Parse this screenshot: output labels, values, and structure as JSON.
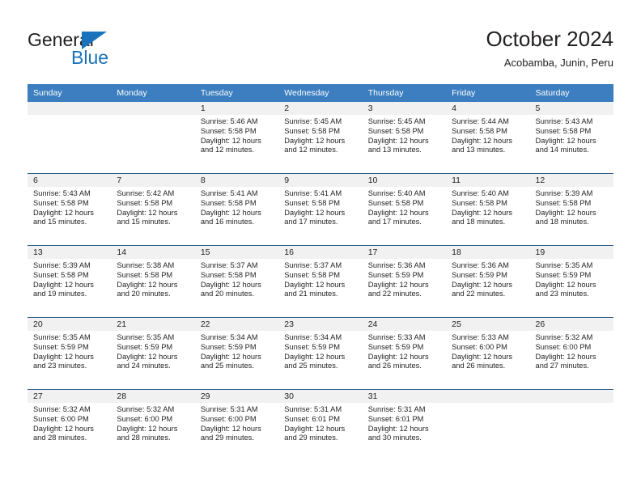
{
  "brand": {
    "name_part1": "General",
    "name_part2": "Blue",
    "triangle_color": "#1a72ba",
    "text_color": "#231f20"
  },
  "header": {
    "title": "October 2024",
    "subtitle": "Acobamba, Junin, Peru"
  },
  "theme": {
    "header_row_bg": "#3c7ebf",
    "header_row_text": "#ffffff",
    "row_separator": "#2e5f8c",
    "daynum_band_bg": "#f1f1f1",
    "cell_bg": "#ffffff",
    "body_text": "#231f20"
  },
  "calendar": {
    "weekday_headers": [
      "Sunday",
      "Monday",
      "Tuesday",
      "Wednesday",
      "Thursday",
      "Friday",
      "Saturday"
    ],
    "labels": {
      "sunrise": "Sunrise:",
      "sunset": "Sunset:",
      "daylight": "Daylight:"
    },
    "weeks": [
      [
        {
          "day": "",
          "line1": "",
          "line2": "",
          "line3": "",
          "line4": ""
        },
        {
          "day": "",
          "line1": "",
          "line2": "",
          "line3": "",
          "line4": ""
        },
        {
          "day": "1",
          "line1": "Sunrise: 5:46 AM",
          "line2": "Sunset: 5:58 PM",
          "line3": "Daylight: 12 hours",
          "line4": "and 12 minutes."
        },
        {
          "day": "2",
          "line1": "Sunrise: 5:45 AM",
          "line2": "Sunset: 5:58 PM",
          "line3": "Daylight: 12 hours",
          "line4": "and 12 minutes."
        },
        {
          "day": "3",
          "line1": "Sunrise: 5:45 AM",
          "line2": "Sunset: 5:58 PM",
          "line3": "Daylight: 12 hours",
          "line4": "and 13 minutes."
        },
        {
          "day": "4",
          "line1": "Sunrise: 5:44 AM",
          "line2": "Sunset: 5:58 PM",
          "line3": "Daylight: 12 hours",
          "line4": "and 13 minutes."
        },
        {
          "day": "5",
          "line1": "Sunrise: 5:43 AM",
          "line2": "Sunset: 5:58 PM",
          "line3": "Daylight: 12 hours",
          "line4": "and 14 minutes."
        }
      ],
      [
        {
          "day": "6",
          "line1": "Sunrise: 5:43 AM",
          "line2": "Sunset: 5:58 PM",
          "line3": "Daylight: 12 hours",
          "line4": "and 15 minutes."
        },
        {
          "day": "7",
          "line1": "Sunrise: 5:42 AM",
          "line2": "Sunset: 5:58 PM",
          "line3": "Daylight: 12 hours",
          "line4": "and 15 minutes."
        },
        {
          "day": "8",
          "line1": "Sunrise: 5:41 AM",
          "line2": "Sunset: 5:58 PM",
          "line3": "Daylight: 12 hours",
          "line4": "and 16 minutes."
        },
        {
          "day": "9",
          "line1": "Sunrise: 5:41 AM",
          "line2": "Sunset: 5:58 PM",
          "line3": "Daylight: 12 hours",
          "line4": "and 17 minutes."
        },
        {
          "day": "10",
          "line1": "Sunrise: 5:40 AM",
          "line2": "Sunset: 5:58 PM",
          "line3": "Daylight: 12 hours",
          "line4": "and 17 minutes."
        },
        {
          "day": "11",
          "line1": "Sunrise: 5:40 AM",
          "line2": "Sunset: 5:58 PM",
          "line3": "Daylight: 12 hours",
          "line4": "and 18 minutes."
        },
        {
          "day": "12",
          "line1": "Sunrise: 5:39 AM",
          "line2": "Sunset: 5:58 PM",
          "line3": "Daylight: 12 hours",
          "line4": "and 18 minutes."
        }
      ],
      [
        {
          "day": "13",
          "line1": "Sunrise: 5:39 AM",
          "line2": "Sunset: 5:58 PM",
          "line3": "Daylight: 12 hours",
          "line4": "and 19 minutes."
        },
        {
          "day": "14",
          "line1": "Sunrise: 5:38 AM",
          "line2": "Sunset: 5:58 PM",
          "line3": "Daylight: 12 hours",
          "line4": "and 20 minutes."
        },
        {
          "day": "15",
          "line1": "Sunrise: 5:37 AM",
          "line2": "Sunset: 5:58 PM",
          "line3": "Daylight: 12 hours",
          "line4": "and 20 minutes."
        },
        {
          "day": "16",
          "line1": "Sunrise: 5:37 AM",
          "line2": "Sunset: 5:58 PM",
          "line3": "Daylight: 12 hours",
          "line4": "and 21 minutes."
        },
        {
          "day": "17",
          "line1": "Sunrise: 5:36 AM",
          "line2": "Sunset: 5:59 PM",
          "line3": "Daylight: 12 hours",
          "line4": "and 22 minutes."
        },
        {
          "day": "18",
          "line1": "Sunrise: 5:36 AM",
          "line2": "Sunset: 5:59 PM",
          "line3": "Daylight: 12 hours",
          "line4": "and 22 minutes."
        },
        {
          "day": "19",
          "line1": "Sunrise: 5:35 AM",
          "line2": "Sunset: 5:59 PM",
          "line3": "Daylight: 12 hours",
          "line4": "and 23 minutes."
        }
      ],
      [
        {
          "day": "20",
          "line1": "Sunrise: 5:35 AM",
          "line2": "Sunset: 5:59 PM",
          "line3": "Daylight: 12 hours",
          "line4": "and 23 minutes."
        },
        {
          "day": "21",
          "line1": "Sunrise: 5:35 AM",
          "line2": "Sunset: 5:59 PM",
          "line3": "Daylight: 12 hours",
          "line4": "and 24 minutes."
        },
        {
          "day": "22",
          "line1": "Sunrise: 5:34 AM",
          "line2": "Sunset: 5:59 PM",
          "line3": "Daylight: 12 hours",
          "line4": "and 25 minutes."
        },
        {
          "day": "23",
          "line1": "Sunrise: 5:34 AM",
          "line2": "Sunset: 5:59 PM",
          "line3": "Daylight: 12 hours",
          "line4": "and 25 minutes."
        },
        {
          "day": "24",
          "line1": "Sunrise: 5:33 AM",
          "line2": "Sunset: 5:59 PM",
          "line3": "Daylight: 12 hours",
          "line4": "and 26 minutes."
        },
        {
          "day": "25",
          "line1": "Sunrise: 5:33 AM",
          "line2": "Sunset: 6:00 PM",
          "line3": "Daylight: 12 hours",
          "line4": "and 26 minutes."
        },
        {
          "day": "26",
          "line1": "Sunrise: 5:32 AM",
          "line2": "Sunset: 6:00 PM",
          "line3": "Daylight: 12 hours",
          "line4": "and 27 minutes."
        }
      ],
      [
        {
          "day": "27",
          "line1": "Sunrise: 5:32 AM",
          "line2": "Sunset: 6:00 PM",
          "line3": "Daylight: 12 hours",
          "line4": "and 28 minutes."
        },
        {
          "day": "28",
          "line1": "Sunrise: 5:32 AM",
          "line2": "Sunset: 6:00 PM",
          "line3": "Daylight: 12 hours",
          "line4": "and 28 minutes."
        },
        {
          "day": "29",
          "line1": "Sunrise: 5:31 AM",
          "line2": "Sunset: 6:00 PM",
          "line3": "Daylight: 12 hours",
          "line4": "and 29 minutes."
        },
        {
          "day": "30",
          "line1": "Sunrise: 5:31 AM",
          "line2": "Sunset: 6:01 PM",
          "line3": "Daylight: 12 hours",
          "line4": "and 29 minutes."
        },
        {
          "day": "31",
          "line1": "Sunrise: 5:31 AM",
          "line2": "Sunset: 6:01 PM",
          "line3": "Daylight: 12 hours",
          "line4": "and 30 minutes."
        },
        {
          "day": "",
          "line1": "",
          "line2": "",
          "line3": "",
          "line4": ""
        },
        {
          "day": "",
          "line1": "",
          "line2": "",
          "line3": "",
          "line4": ""
        }
      ]
    ]
  }
}
